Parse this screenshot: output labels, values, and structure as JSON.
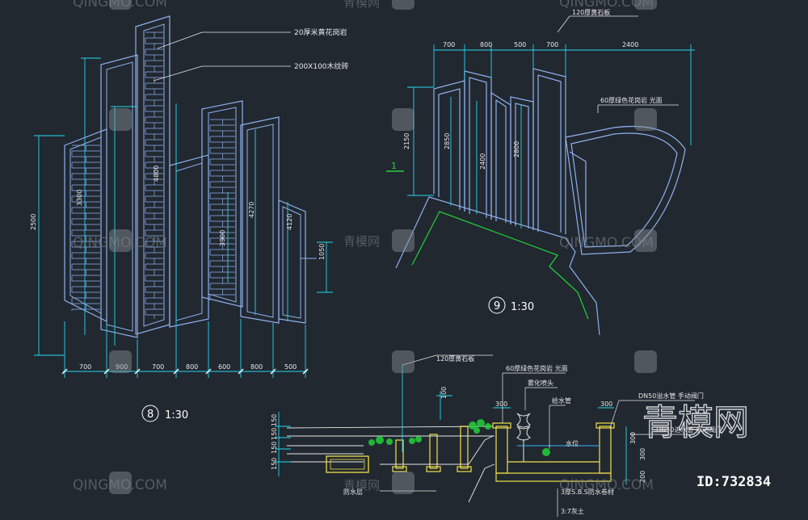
{
  "drawing8": {
    "labels": [
      "20厚米黄花岗岩",
      "200X100木纹砖"
    ],
    "dims_bottom": [
      "700",
      "900",
      "700",
      "800",
      "600",
      "800",
      "500"
    ],
    "dims_vertical": [
      "2500",
      "3300",
      "4800",
      "4270",
      "3900",
      "4120",
      "1050"
    ],
    "scale_no": "8",
    "scale": "1:30"
  },
  "drawing9": {
    "dims_top": [
      "700",
      "800",
      "500",
      "700",
      "2400"
    ],
    "dims_vertical": [
      "2150",
      "2850",
      "2400",
      "2800"
    ],
    "labels": [
      "120厚黄石板",
      "60厚绿色花岗岩  光面"
    ],
    "marker": "1",
    "scale_no": "9",
    "scale": "1:30"
  },
  "section": {
    "labels": [
      "120厚黄石板",
      "60厚绿色花岗岩  光面",
      "雾化喷头",
      "给水管",
      "水位",
      "DN50溢水管  手动阀门",
      "DN50进水管  手动阀门",
      "防水层",
      "3厚S.B.S防水卷材",
      "3:7灰土"
    ],
    "dims_top": [
      "100",
      "300",
      "300"
    ],
    "dims_left": [
      "150",
      "150",
      "150",
      "150"
    ],
    "dims_right": [
      "300",
      "300",
      "200"
    ]
  },
  "watermark": {
    "text": "QINGMO.COM",
    "cn": "青模网",
    "big": "青模网",
    "id": "ID:732834"
  },
  "colors": {
    "background": "#212830",
    "outline": "#8fb0ee",
    "dimension": "#25d7ef",
    "leader": "#33b6ff",
    "green": "#22d13a",
    "yellow": "#f2e24a",
    "text": "#e8e8e8"
  }
}
